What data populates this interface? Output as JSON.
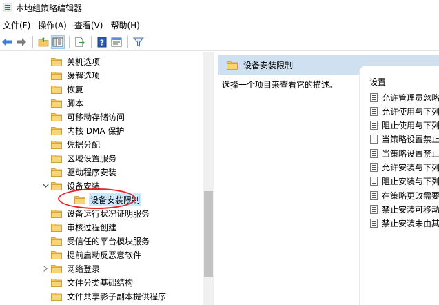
{
  "window": {
    "title": "本地组策略编辑器"
  },
  "menu": [
    {
      "label": "文件(F)"
    },
    {
      "label": "操作(A)"
    },
    {
      "label": "查看(V)"
    },
    {
      "label": "帮助(H)"
    }
  ],
  "toolbar": {
    "icons": [
      "back-arrow-icon",
      "forward-arrow-icon",
      "up-folder-icon",
      "show-hide-tree-icon",
      "export-list-icon",
      "help-icon",
      "properties-icon",
      "filter-icon"
    ]
  },
  "tree": {
    "items": [
      {
        "label": "关机选项"
      },
      {
        "label": "缓解选项"
      },
      {
        "label": "恢复"
      },
      {
        "label": "脚本"
      },
      {
        "label": "可移动存储访问"
      },
      {
        "label": "内核 DMA 保护"
      },
      {
        "label": "凭据分配"
      },
      {
        "label": "区域设置服务"
      },
      {
        "label": "驱动程序安装"
      },
      {
        "label": "设备安装",
        "expander": "expanded"
      },
      {
        "label": "设备安装限制",
        "selected": true
      },
      {
        "label": "设备运行状况证明服务"
      },
      {
        "label": "审核过程创建"
      },
      {
        "label": "受信任的平台模块服务"
      },
      {
        "label": "提前启动反恶意软件"
      },
      {
        "label": "网络登录",
        "expander": "collapsed"
      },
      {
        "label": "文件分类基础结构"
      },
      {
        "label": "文件共享影子副本提供程序"
      }
    ]
  },
  "right_pane": {
    "header": "设备安装限制",
    "description": "选择一个项目来查看它的描述。",
    "settings_header": "设置",
    "settings": [
      {
        "label": "允许管理员忽略"
      },
      {
        "label": "允许使用与下列"
      },
      {
        "label": "阻止使用与下列"
      },
      {
        "label": "当策略设置禁止"
      },
      {
        "label": "当策略设置禁止"
      },
      {
        "label": "允许安装与下列"
      },
      {
        "label": "阻止安装与下列"
      },
      {
        "label": "在策略更改需要"
      },
      {
        "label": "禁止安装可移动"
      },
      {
        "label": "禁止安装未由其"
      }
    ]
  },
  "colors": {
    "folder": "#f3c660",
    "header_bg": "#cfe1f0",
    "highlight": "#e3262b",
    "toolbar_active": "#cce4f7"
  }
}
